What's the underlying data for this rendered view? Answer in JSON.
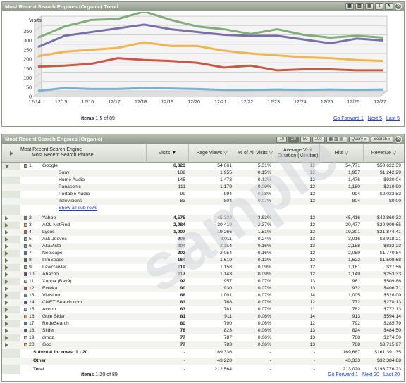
{
  "chart_panel": {
    "title": "Most Recent Search Engines (Organic) Trend",
    "footer_prefix": "items",
    "footer_range": "1-5 of 89",
    "nav": [
      "Go Forward 1",
      "Next 5",
      "Last 5"
    ]
  },
  "chart_data": {
    "type": "line",
    "ylabel": "Visits",
    "ylim": [
      0,
      400
    ],
    "yticks": [
      "0",
      "50",
      "100",
      "150",
      "200",
      "250",
      "300",
      "350"
    ],
    "categories": [
      "12/14",
      "12/15",
      "12/16",
      "12/17",
      "12/18",
      "12/19",
      "12/20",
      "12/21",
      "12/22",
      "12/23",
      "12/24",
      "12/25",
      "12/26",
      "12/27"
    ],
    "series": [
      {
        "color": "#7fae7a",
        "values": [
          300,
          360,
          395,
          400,
          440,
          395,
          360,
          345,
          320,
          345,
          315,
          300,
          310,
          300
        ]
      },
      {
        "color": "#7b6fa8",
        "values": [
          250,
          310,
          330,
          350,
          370,
          345,
          330,
          315,
          310,
          310,
          290,
          270,
          295,
          285
        ]
      },
      {
        "color": "#f0b550",
        "values": [
          200,
          225,
          235,
          245,
          275,
          255,
          255,
          230,
          215,
          205,
          195,
          190,
          180,
          175
        ]
      },
      {
        "color": "#c85a45",
        "values": [
          145,
          150,
          160,
          190,
          180,
          175,
          165,
          140,
          150,
          125,
          130,
          130,
          125,
          125
        ]
      },
      {
        "color": "#7ab0d0",
        "values": [
          15,
          30,
          25,
          25,
          30,
          28,
          25,
          20,
          20,
          22,
          20,
          22,
          20,
          22
        ]
      }
    ]
  },
  "table_panel": {
    "title": "Most Recent Search Engines (Organic)",
    "toolbar": {
      "p10": "10",
      "p20": "20",
      "p50": "50",
      "p100": "100",
      "query": "Query",
      "search": "Search",
      "close": "x"
    },
    "columns": {
      "engine_line1": "Most Recent Search Engine",
      "engine_line2": "Most Recent Search Phrase",
      "visits": "Visits",
      "page_views": "Page Views",
      "pct_visits": "% of All Visits",
      "duration": "Average Visit Duration (Minutes)",
      "hits": "Hits",
      "revenue": "Revenue"
    },
    "rows": [
      {
        "idx": "1.",
        "name": "Google",
        "color": "#7fae7a",
        "expanded": true,
        "visits": "6,823",
        "pv": "54,661",
        "pct": "5.31%",
        "dur": "12",
        "hits": "54,771",
        "rev": "$50,622.39"
      },
      {
        "sub": true,
        "name": "Sony",
        "visits": "182",
        "pv": "1,955",
        "pct": "0.15%",
        "dur": "12",
        "hits": "1,957",
        "rev": "$1,242.29"
      },
      {
        "sub": true,
        "name": "Home Audio",
        "visits": "145",
        "pv": "1,473",
        "pct": "0.12%",
        "dur": "12",
        "hits": "1,476",
        "rev": "$920.04"
      },
      {
        "sub": true,
        "name": "Panasonic",
        "visits": "111",
        "pv": "1,179",
        "pct": "0.09%",
        "dur": "12",
        "hits": "1,180",
        "rev": "$210.90"
      },
      {
        "sub": true,
        "name": "Portable Audio",
        "visits": "99",
        "pv": "994",
        "pct": "0.08%",
        "dur": "12",
        "hits": "994",
        "rev": "$2,023.53"
      },
      {
        "sub": true,
        "name": "Televisions",
        "visits": "83",
        "pv": "804",
        "pct": "0.07%",
        "dur": "12",
        "hits": "804",
        "rev": "$0.00"
      },
      {
        "showall": true,
        "name": "Show all sub-rows"
      },
      {
        "idx": "2.",
        "name": "Yahoo",
        "color": "#7b6fa8",
        "visits": "4,575",
        "pv": "45,322",
        "pct": "3.63%",
        "dur": "12",
        "hits": "45,416",
        "rev": "$42,860.32"
      },
      {
        "idx": "3.",
        "name": "AOL NetFind",
        "color": "#f0b550",
        "visits": "2,984",
        "pv": "30,419",
        "pct": "2.37%",
        "dur": "12",
        "hits": "30,477",
        "rev": "$29,909.65"
      },
      {
        "idx": "4.",
        "name": "Lycos",
        "color": "#c85a45",
        "visits": "1,907",
        "pv": "19,266",
        "pct": "1.51%",
        "dur": "12",
        "hits": "19,301",
        "rev": "$21,874.41"
      },
      {
        "idx": "5.",
        "name": "Ask Jeeves",
        "color": "#7ab0d0",
        "visits": "296",
        "pv": "3,011",
        "pct": "0.24%",
        "dur": "13",
        "hits": "3,016",
        "rev": "$3,918.21"
      },
      {
        "idx": "6.",
        "name": "AltaVista",
        "color": "#6a8fc0",
        "visits": "204",
        "pv": "2,154",
        "pct": "0.16%",
        "dur": "13",
        "hits": "2,158",
        "rev": "$832.23"
      },
      {
        "idx": "7.",
        "name": "Netscape",
        "color": "#4a72b0",
        "visits": "202",
        "pv": "2,054",
        "pct": "0.16%",
        "dur": "12",
        "hits": "2,059",
        "rev": "$1,770.84"
      },
      {
        "idx": "8.",
        "name": "InfoSpace",
        "color": "#2f6f3a",
        "visits": "164",
        "pv": "1,619",
        "pct": "0.13%",
        "dur": "12",
        "hits": "1,622",
        "rev": "$1,508.68"
      },
      {
        "idx": "9.",
        "name": "Lawcrawler",
        "color": "#8fbf6a",
        "visits": "119",
        "pv": "1,158",
        "pct": "0.09%",
        "dur": "12",
        "hits": "1,161",
        "rev": "$27.56"
      },
      {
        "idx": "10.",
        "name": "Abacho",
        "color": "#5a3a70",
        "visits": "117",
        "pv": "1,143",
        "pct": "0.09%",
        "dur": "12",
        "hits": "1,149",
        "rev": "$253.33"
      },
      {
        "idx": "11.",
        "name": "Xuppa (Bay9)",
        "color": "#a8b8d8",
        "visits": "92",
        "pv": "957",
        "pct": "0.07%",
        "dur": "13",
        "hits": "961",
        "rev": "$509.86"
      },
      {
        "idx": "12.",
        "name": "Evreka",
        "color": "#b04a40",
        "visits": "90",
        "pv": "930",
        "pct": "0.07%",
        "dur": "13",
        "hits": "932",
        "rev": "$406.71"
      },
      {
        "idx": "13.",
        "name": "Vivisimo",
        "color": "#5a90b0",
        "visits": "88",
        "pv": "1,001",
        "pct": "0.07%",
        "dur": "14",
        "hits": "1,005",
        "rev": "$528.00"
      },
      {
        "idx": "14.",
        "name": "CNET Search.com",
        "color": "#6a3a8a",
        "visits": "83",
        "pv": "768",
        "pct": "0.07%",
        "dur": "12",
        "hits": "772",
        "rev": "$270.13"
      },
      {
        "idx": "15.",
        "name": "Acoon",
        "color": "#8ab0d8",
        "visits": "83",
        "pv": "781",
        "pct": "0.07%",
        "dur": "11",
        "hits": "782",
        "rev": "$772.13"
      },
      {
        "idx": "16.",
        "name": "Gule Sider",
        "color": "#d89a40",
        "visits": "81",
        "pv": "911",
        "pct": "0.06%",
        "dur": "14",
        "hits": "913",
        "rev": "$594.14"
      },
      {
        "idx": "17.",
        "name": "RedeSearch",
        "color": "#3a8a8a",
        "visits": "80",
        "pv": "790",
        "pct": "0.06%",
        "dur": "12",
        "hits": "792",
        "rev": "$285.79"
      },
      {
        "idx": "18.",
        "name": "Slider",
        "color": "#5a4a80",
        "visits": "78",
        "pv": "823",
        "pct": "0.06%",
        "dur": "13",
        "hits": "824",
        "rev": "$484.50"
      },
      {
        "idx": "19.",
        "name": "dmoz",
        "color": "#c0c0e0",
        "visits": "77",
        "pv": "787",
        "pct": "0.06%",
        "dur": "13",
        "hits": "788",
        "rev": "$274.50"
      },
      {
        "idx": "20.",
        "name": "Goo",
        "color": "#f0c040",
        "visits": "77",
        "pv": "783",
        "pct": "0.06%",
        "dur": "13",
        "hits": "788",
        "rev": "$3,715.97"
      }
    ],
    "totals": [
      {
        "label": "Subtotal for rows: 1 - 20",
        "visits": "-",
        "pv": "169,336",
        "pct": "-",
        "dur": "-",
        "hits": "169,687",
        "rev": "$161,391.35"
      },
      {
        "label": "Other",
        "visits": "-",
        "pv": "43,228",
        "pct": "-",
        "dur": "-",
        "hits": "43,333",
        "rev": "$32,384.88"
      },
      {
        "label": "Total",
        "visits": "-",
        "pv": "212,564",
        "pct": "-",
        "dur": "-",
        "hits": "213,020",
        "rev": "$193,776.23"
      }
    ],
    "footer_prefix": "items",
    "footer_range": "1-20 of 89",
    "nav": [
      "Go Forward 1",
      "Next 20",
      "Last 20"
    ]
  },
  "watermark": "sample"
}
